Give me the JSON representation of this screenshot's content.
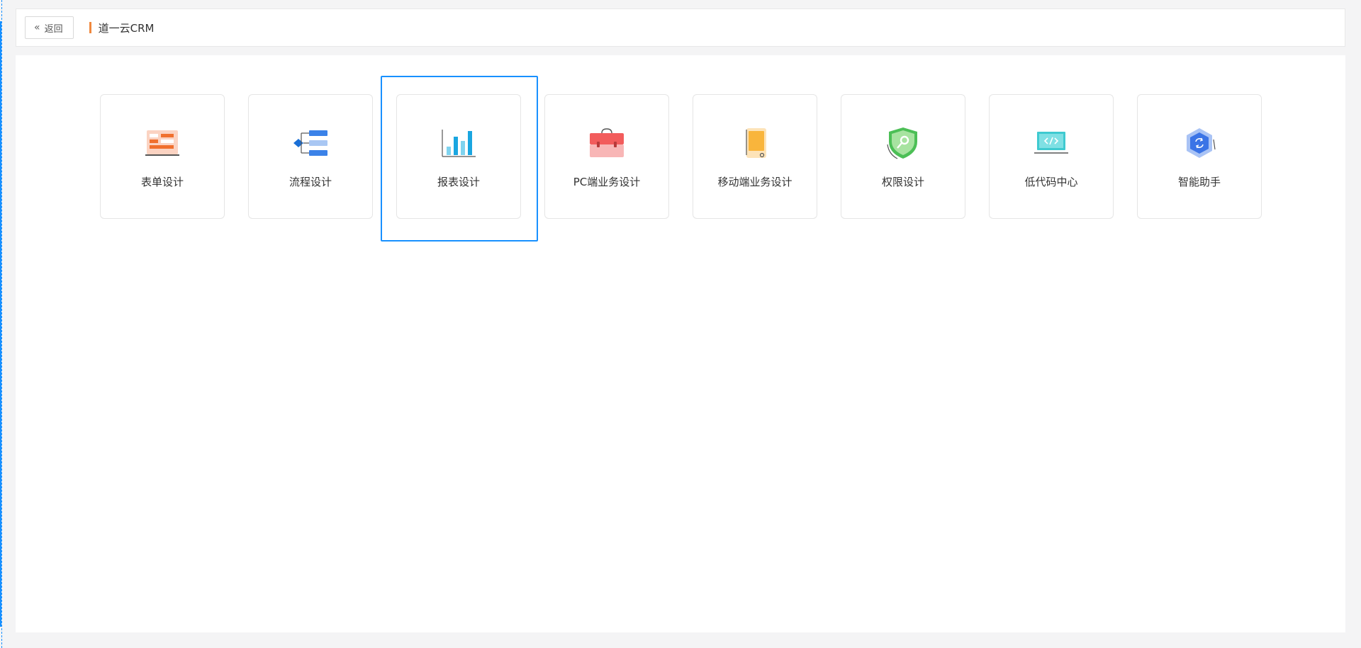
{
  "header": {
    "back_label": "返回",
    "title": "道一云CRM"
  },
  "cards": [
    {
      "label": "表单设计",
      "icon": "form-design-icon"
    },
    {
      "label": "流程设计",
      "icon": "flow-design-icon"
    },
    {
      "label": "报表设计",
      "icon": "report-design-icon",
      "selected": true
    },
    {
      "label": "PC端业务设计",
      "icon": "pc-business-icon"
    },
    {
      "label": "移动端业务设计",
      "icon": "mobile-business-icon"
    },
    {
      "label": "权限设计",
      "icon": "permission-shield-icon"
    },
    {
      "label": "低代码中心",
      "icon": "low-code-icon"
    },
    {
      "label": "智能助手",
      "icon": "smart-assistant-icon"
    }
  ],
  "colors": {
    "accent": "#1890ff",
    "title_marker": "#f0883e"
  }
}
